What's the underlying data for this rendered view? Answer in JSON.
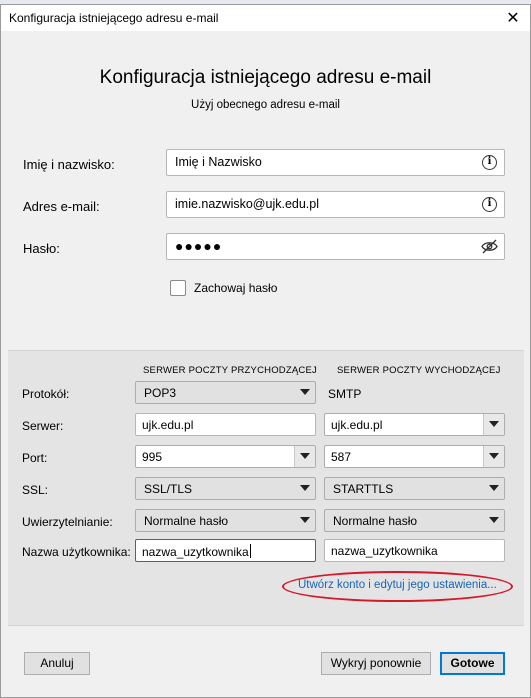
{
  "window": {
    "title": "Konfiguracja istniejącego adresu e-mail",
    "close_glyph": "✕"
  },
  "header": {
    "title": "Konfiguracja istniejącego adresu e-mail",
    "subtitle": "Użyj obecnego adresu e-mail"
  },
  "form": {
    "name_label": "Imię i nazwisko:",
    "name_value": "Imię i Nazwisko",
    "email_label": "Adres e-mail:",
    "email_value": "imie.nazwisko@ujk.edu.pl",
    "password_label": "Hasło:",
    "password_value": "●●●●●",
    "remember_label": "Zachowaj hasło",
    "remember_checked": false,
    "info_icon": "i"
  },
  "servers": {
    "incoming_header": "SERWER POCZTY PRZYCHODZĄCEJ",
    "outgoing_header": "SERWER POCZTY WYCHODZĄCEJ",
    "rows": {
      "protocol": {
        "label": "Protokół:",
        "incoming": "POP3",
        "outgoing": "SMTP"
      },
      "server": {
        "label": "Serwer:",
        "incoming": "ujk.edu.pl",
        "outgoing": "ujk.edu.pl"
      },
      "port": {
        "label": "Port:",
        "incoming": "995",
        "outgoing": "587"
      },
      "ssl": {
        "label": "SSL:",
        "incoming": "SSL/TLS",
        "outgoing": "STARTTLS"
      },
      "auth": {
        "label": "Uwierzytelnianie:",
        "incoming": "Normalne hasło",
        "outgoing": "Normalne hasło"
      },
      "username": {
        "label": "Nazwa użytkownika:",
        "incoming": "nazwa_uzytkownika",
        "outgoing": "nazwa_uzytkownika"
      }
    },
    "advanced_link": "Utwórz konto i edytuj jego ustawienia..."
  },
  "footer": {
    "cancel": "Anuluj",
    "retest": "Wykryj ponownie",
    "done": "Gotowe"
  },
  "colors": {
    "link": "#1565c0",
    "highlight_oval": "#d5172b",
    "focus": "#0078d7"
  }
}
